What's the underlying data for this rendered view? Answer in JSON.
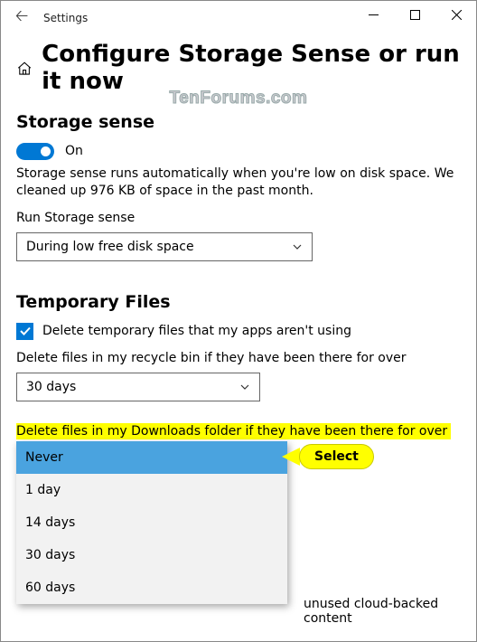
{
  "titlebar": {
    "app_name": "Settings"
  },
  "header": {
    "title": "Configure Storage Sense or run it now"
  },
  "watermark": "TenForums.com",
  "storage_sense": {
    "heading": "Storage sense",
    "toggle_state": "On",
    "desc": "Storage sense runs automatically when you're low on disk space. We cleaned up 976 KB of space in the past month.",
    "run_label": "Run Storage sense",
    "run_value": "During low free disk space"
  },
  "temp": {
    "heading": "Temporary Files",
    "chk_label": "Delete temporary files that my apps aren't using",
    "recycle_label": "Delete files in my recycle bin if they have been there for over",
    "recycle_value": "30 days",
    "downloads_label": "Delete files in my Downloads folder if they have been there for over",
    "options": [
      "Never",
      "1 day",
      "14 days",
      "30 days",
      "60 days"
    ]
  },
  "callout": "Select",
  "cloud_fragment": "unused cloud-backed content"
}
